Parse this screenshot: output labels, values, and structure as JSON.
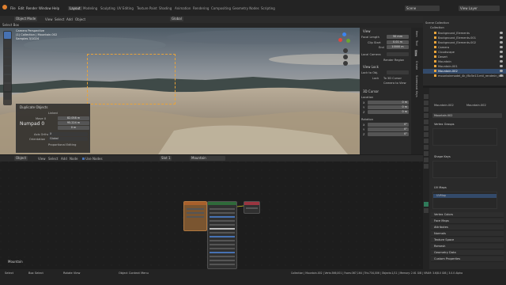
{
  "top_menu": [
    "File",
    "Edit",
    "Render",
    "Window",
    "Help"
  ],
  "workspaces": [
    "Layout",
    "Modeling",
    "Sculpting",
    "UV Editing",
    "Texture Paint",
    "Shading",
    "Animation",
    "Rendering",
    "Compositing",
    "Geometry Nodes",
    "Scripting"
  ],
  "active_workspace": "Layout",
  "scene": {
    "name": "Scene",
    "view_layer": "View Layer"
  },
  "viewport_header": {
    "mode": "Object Mode",
    "view": "View",
    "select": "Select",
    "add": "Add",
    "object": "Object",
    "orientation": "Global",
    "select_box": "Select Box"
  },
  "viewport_overlay": {
    "line1": "Camera Perspective",
    "line2": "(1) Collection | Mountain.002",
    "line3": "Samples 3/1024"
  },
  "n_panel": {
    "tabs": [
      "Item",
      "Tool",
      "View",
      "Create",
      "Screencast Keys"
    ],
    "view_header": "View",
    "focal_length_label": "Focal Length",
    "focal_length": "50 mm",
    "clip_start_label": "Clip Start",
    "clip_start": "0.01 m",
    "clip_end_label": "End",
    "clip_end": "10000 m",
    "local_camera_label": "Local Camera",
    "render_region": "Render Region",
    "view_lock_header": "View Lock",
    "lock_to_obj": "Lock to Obj.",
    "lock_label": "Lock",
    "to_3d_cursor": "To 3D Cursor",
    "camera_to_view": "Camera to View",
    "cursor_header": "3D Cursor",
    "location_label": "Location",
    "x_label": "X",
    "x": "0 m",
    "y_label": "Y",
    "y": "0 m",
    "z_label": "Z",
    "z": "0 m",
    "rotation_label": "Rotation",
    "rx_label": "X",
    "rx": "0°",
    "ry_label": "Y",
    "ry": "0°",
    "rz_label": "Z",
    "rz": "0°"
  },
  "duplicate_panel": {
    "title": "Duplicate Objects",
    "linked": "Linked",
    "move_label": "Move X",
    "mx": "82.058 m",
    "my": "95.224 m",
    "mz": "0 m",
    "key": "Numpad 0",
    "axis_ortho_label": "Axis Ortho",
    "axis_ortho": "X",
    "orientation_label": "Orientation",
    "orientation": "Global",
    "proportional": "Proportional Editing"
  },
  "node_header": {
    "object": "Object",
    "view": "View",
    "select": "Select",
    "add": "Add",
    "node": "Node",
    "use_nodes": "Use Nodes",
    "slot": "Slot 1",
    "material": "Mountain"
  },
  "node_editor_label": "Mountain",
  "outliner": {
    "root": "Scene Collection",
    "collection": "Collection",
    "items": [
      {
        "name": "Background_Elements",
        "selected": false
      },
      {
        "name": "Background_Elements.001",
        "selected": false
      },
      {
        "name": "Background_Elements.002",
        "selected": false
      },
      {
        "name": "Camera",
        "selected": false
      },
      {
        "name": "Cloudscape",
        "selected": false
      },
      {
        "name": "Desert",
        "selected": false
      },
      {
        "name": "Mountain",
        "selected": false
      },
      {
        "name": "Mountain.001",
        "selected": false
      },
      {
        "name": "Mountain.002",
        "selected": true
      },
      {
        "name": "mountainmodel_4k_f8c5e13.mtl_rendmin_b95",
        "selected": false
      }
    ]
  },
  "properties": {
    "object_name": "Mountain.002",
    "mesh_label": "Mountain.002",
    "mesh_name": "Mountain.002",
    "sections": [
      "Vertex Groups",
      "Shape Keys",
      "UV Maps"
    ],
    "uv_map": "UVMap",
    "collapsed": [
      "Vertex Colors",
      "Face Maps",
      "Attributes",
      "Normals",
      "Texture Space",
      "Remesh",
      "Geometry Data",
      "Custom Properties"
    ]
  },
  "status_bar": {
    "left1": "Select",
    "left2": "Box Select",
    "left3": "Rotate View",
    "left4": "Object Context Menu",
    "right": "Collection | Mountain.002 | Verts:366,001 | Faces:367,164 | Tris:734,006 | Objects:1/11 | Memory: 2.61 GiB | VRAM: 3.6/8.0 GiB | 3.0.0 Alpha"
  },
  "colors": {
    "accent": "#4772b3",
    "active_obj": "#e8a33a",
    "node_frame": "#2f6a3a"
  }
}
